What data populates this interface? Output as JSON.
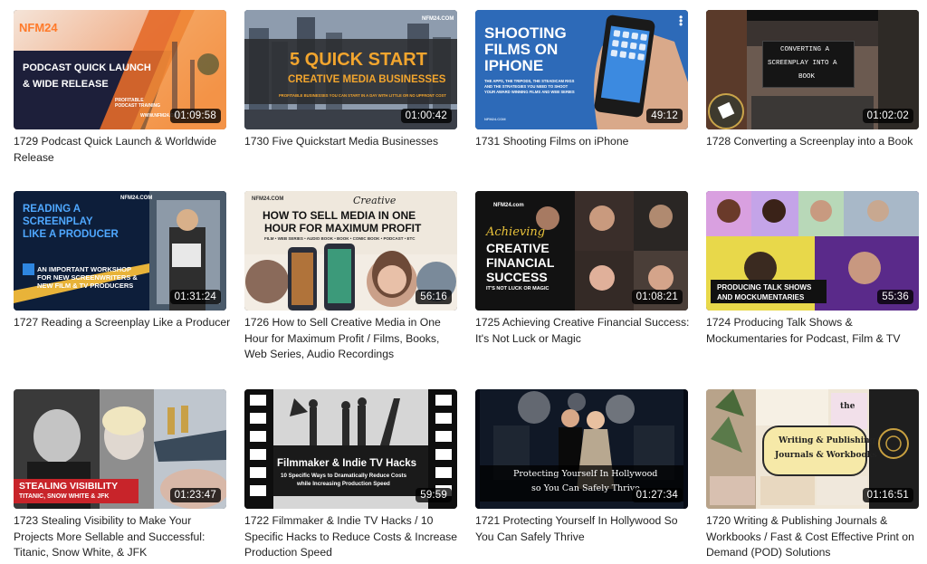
{
  "videos": [
    {
      "title": "1729 Podcast Quick Launch & Worldwide Release",
      "duration": "01:09:58",
      "thumb_text": {
        "brand": "NFM24",
        "line1": "PODCAST QUICK LAUNCH",
        "line2": "& WIDE RELEASE",
        "sub": "PROFITABLE PODCAST TRAINING",
        "url": "WWW.NFM24.COM"
      }
    },
    {
      "title": "1730 Five Quickstart Media Businesses",
      "duration": "01:00:42",
      "thumb_text": {
        "brand": "NFM24.COM",
        "line1": "5 QUICK START",
        "line2": "CREATIVE MEDIA BUSINESSES",
        "sub": "PROFITABLE BUSINESSES YOU CAN START IN A DAY WITH LITTLE OR NO UPFRONT COST"
      }
    },
    {
      "title": "1731 Shooting Films on iPhone",
      "duration": "49:12",
      "thumb_text": {
        "line1": "SHOOTING",
        "line2": "FILMS ON",
        "line3": "IPHONE",
        "sub": "THE APPS, THE TRIPODS, THE STEADICAM RIGS AND THE STRATEGIES YOU NEED TO SHOOT YOUR AWARD WINNING FILMS AND WEB SERIES",
        "brand": "NFM24.COM"
      }
    },
    {
      "title": "1728 Converting a Screenplay into a Book",
      "duration": "01:02:02",
      "thumb_text": {
        "line1": "CONVERTING A",
        "line2": "SCREENPLAY INTO A",
        "line3": "BOOK"
      }
    },
    {
      "title": "1727 Reading a Screenplay Like a Producer",
      "duration": "01:31:24",
      "thumb_text": {
        "brand": "NFM24.COM",
        "line1": "READING A",
        "line2": "SCREENPLAY",
        "line3": "LIKE A PRODUCER",
        "sub1": "AN IMPORTANT WORKSHOP",
        "sub2": "FOR NEW SCREENWRITERS &",
        "sub3": "NEW FILM & TV PRODUCERS"
      }
    },
    {
      "title": "1726 How to Sell Creative Media in One Hour for Maximum Profit / Films, Books, Web Series, Audio Recordings",
      "duration": "56:16",
      "thumb_text": {
        "brand": "NFM24.COM",
        "script": "Creative",
        "line1": "HOW TO SELL MEDIA IN ONE",
        "line2": "HOUR FOR MAXIMUM PROFIT",
        "sub": "FILM • WEB SERIES • AUDIO BOOK • BOOK • COMIC BOOK • PODCAST • ETC"
      }
    },
    {
      "title": "1725 Achieving Creative Financial Success: It's Not Luck or Magic",
      "duration": "01:08:21",
      "thumb_text": {
        "brand": "NFM24.com",
        "script": "Achieving",
        "line1": "CREATIVE",
        "line2": "FINANCIAL",
        "line3": "SUCCESS",
        "sub": "IT'S NOT LUCK OR MAGIC"
      }
    },
    {
      "title": "1724 Producing Talk Shows & Mockumentaries for Podcast, Film & TV",
      "duration": "55:36",
      "thumb_text": {
        "line1": "PRODUCING TALK SHOWS",
        "line2": "AND MOCKUMENTARIES"
      }
    },
    {
      "title": "1723 Stealing Visibility to Make Your Projects More Sellable and Successful: Titanic, Snow White, & JFK",
      "duration": "01:23:47",
      "thumb_text": {
        "line1": "STEALING VISIBILITY",
        "line2": "TITANIC, SNOW WHITE & JFK"
      }
    },
    {
      "title": "1722 Filmmaker & Indie TV Hacks / 10 Specific Hacks to Reduce Costs & Increase Production Speed",
      "duration": "59:59",
      "thumb_text": {
        "line1": "Filmmaker & Indie TV Hacks",
        "line2": "10 Specific Ways to Dramatically Reduce Costs",
        "line3": "while Increasing Production Speed"
      }
    },
    {
      "title": "1721 Protecting Yourself In Hollywood So You Can Safely Thrive",
      "duration": "01:27:34",
      "thumb_text": {
        "line1": "Protecting Yourself In Hollywood",
        "line2": "so You Can Safely Thrive"
      }
    },
    {
      "title": "1720 Writing & Publishing Journals & Workbooks / Fast & Cost Effective Print on Demand (POD) Solutions",
      "duration": "01:16:51",
      "thumb_text": {
        "line1": "Writing & Publishing",
        "line2": "Journals & Workbooks",
        "small": "the"
      }
    }
  ]
}
